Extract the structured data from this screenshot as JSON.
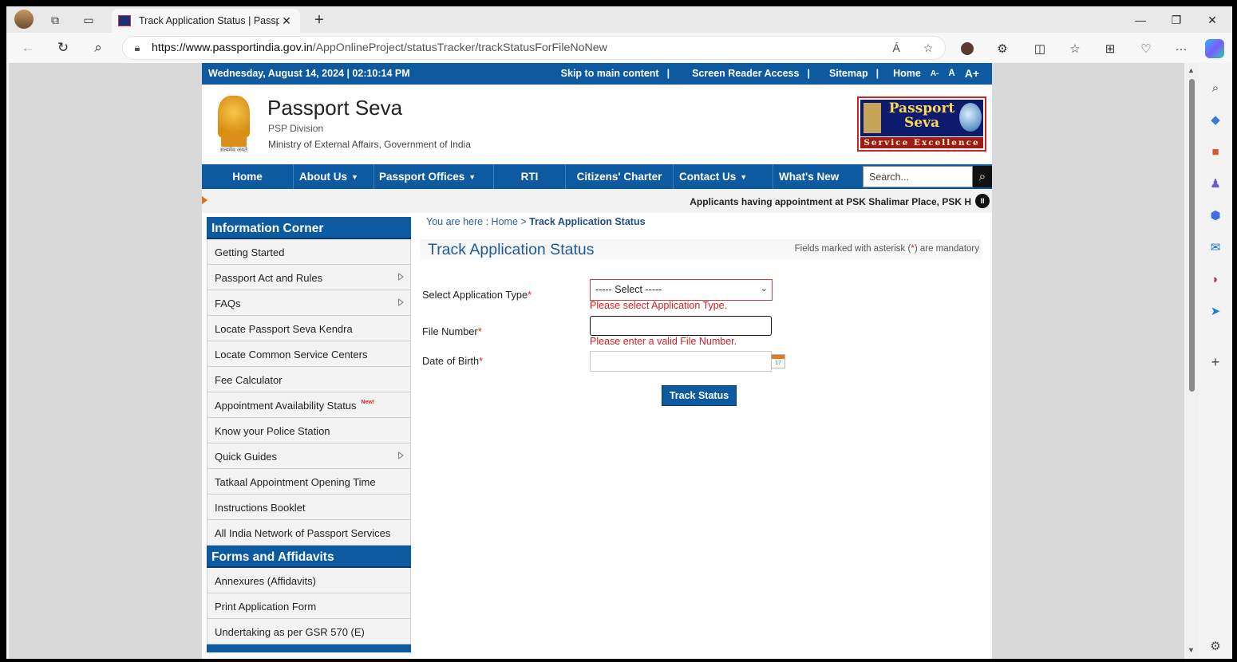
{
  "browser": {
    "tab_title": "Track Application Status | Passpo",
    "tab_close": "✕",
    "new_tab": "+",
    "url_host": "https://www.passportindia.gov.in",
    "url_path": "/AppOnlineProject/statusTracker/trackStatusForFileNoNew",
    "read_aloud": "Á",
    "favorite": "☆",
    "minimize": "—",
    "restore": "❐",
    "close": "✕",
    "more": "···"
  },
  "site": {
    "topbar": {
      "date": "Wednesday,  August  14, 2024 | 02:10:14 PM",
      "skip": "Skip to main content",
      "reader": "Screen Reader Access",
      "sitemap": "Sitemap",
      "home": "Home",
      "font_small": "A-",
      "font_normal": "A",
      "font_large": "A+",
      "sep": "|"
    },
    "header": {
      "title": "Passport Seva",
      "sub1": "PSP Division",
      "sub2": "Ministry of External Affairs, Government of India",
      "emblem_text": "सत्यमेव जयते",
      "logo_word": "Passport Seva",
      "logo_band": "Service Excellence"
    },
    "nav": {
      "items": [
        "Home",
        "About Us",
        "Passport Offices",
        "RTI",
        "Citizens' Charter",
        "Contact Us",
        "What's New"
      ],
      "caret": "▼",
      "search_placeholder": "Search..."
    },
    "ticker": {
      "message": "Applicants having appointment at PSK Shalimar Place, PSK H",
      "pause": "II"
    },
    "sidebar": {
      "info_heading": "Information Corner",
      "info_items": [
        "Getting Started",
        "Passport Act and Rules",
        "FAQs",
        "Locate Passport Seva Kendra",
        "Locate Common Service Centers",
        "Fee Calculator",
        "Appointment Availability Status",
        "Know your Police Station",
        "Quick Guides",
        "Tatkaal Appointment Opening Time",
        "Instructions Booklet",
        "All India Network of Passport Services"
      ],
      "new_badge": "New!",
      "forms_heading": "Forms and Affidavits",
      "forms_items": [
        "Annexures (Affidavits)",
        "Print Application Form",
        "Undertaking as per GSR 570 (E)"
      ]
    },
    "content": {
      "crumb_prefix": "You are here : ",
      "crumb_home": "Home",
      "crumb_sep": " > ",
      "crumb_current": "Track Application Status",
      "title": "Track Application Status",
      "mandatory_pre": "Fields marked with asterisk (",
      "mandatory_ast": "*",
      "mandatory_post": ") are mandatory",
      "label_apptype": "Select Application Type",
      "label_fileno": "File Number",
      "label_dob": "Date of Birth",
      "asterisk": "*",
      "select_value": "----- Select -----",
      "err_apptype": "Please select Application Type.",
      "err_fileno": "Please enter a valid File Number.",
      "cal_num": "17",
      "track_button": "Track Status"
    }
  }
}
